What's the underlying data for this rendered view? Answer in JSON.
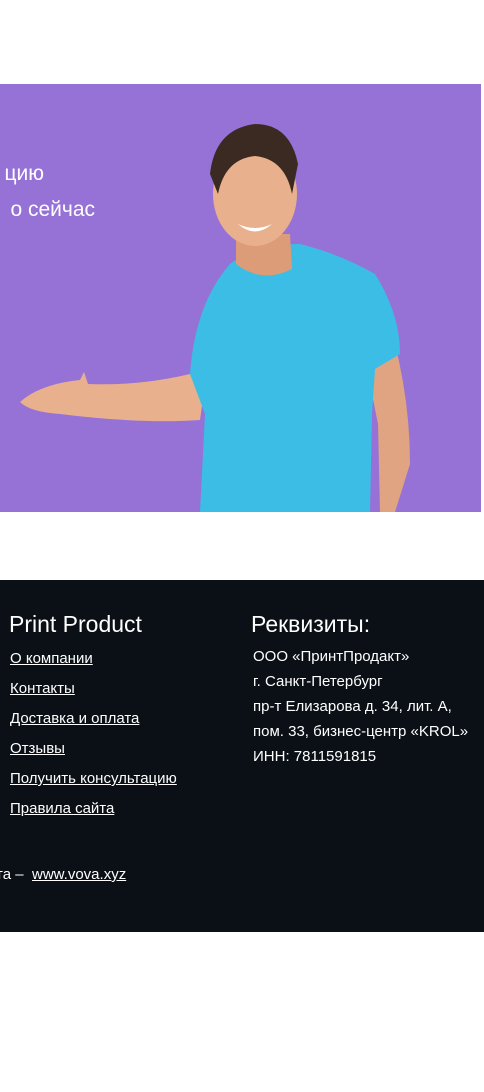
{
  "banner": {
    "line1": "цию",
    "line2": "о сейчас",
    "bg_color": "#9672d7"
  },
  "footer": {
    "brand_title": "Print Product",
    "links": [
      "О компании",
      "Контакты",
      "Доставка и оплата",
      "Отзывы",
      "Получить консультацию",
      "Правила сайта"
    ],
    "requisites_title": "Реквизиты:",
    "requisites": [
      "ООО «ПринтПродакт»",
      "г. Санкт-Петербург",
      "пр-т Елизарова д. 34, лит. А,",
      "пом. 33, бизнес-центр «KROL»",
      "ИНН: 7811591815"
    ],
    "credit_prefix": "та –",
    "credit_link": "www.vova.xyz",
    "bg_color": "#0a1016"
  }
}
